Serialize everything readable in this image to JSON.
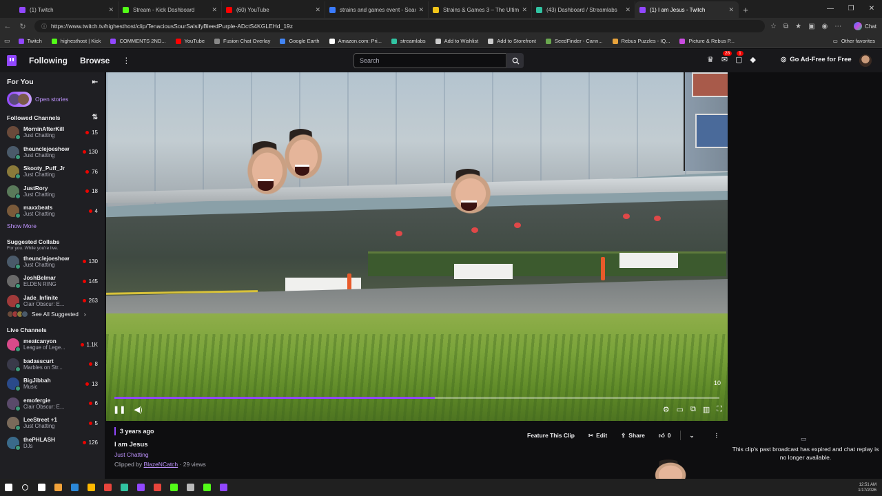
{
  "browser": {
    "tabs": [
      {
        "title": "(1) Twitch",
        "color": "#9147ff",
        "active": false
      },
      {
        "title": "Stream - Kick Dashboard",
        "color": "#53fc18",
        "active": false
      },
      {
        "title": "(60) YouTube",
        "color": "#ff0000",
        "active": false
      },
      {
        "title": "strains and games event - Search",
        "color": "#3a7bff",
        "active": false
      },
      {
        "title": "Strains & Games 3 – The Ultimate",
        "color": "#f0c419",
        "active": false
      },
      {
        "title": "(43) Dashboard / Streamlabs",
        "color": "#31c3a2",
        "active": false
      },
      {
        "title": "(1) I am Jesus - Twitch",
        "color": "#9147ff",
        "active": true
      }
    ],
    "url": "https://www.twitch.tv/highesthost/clip/TenaciousSourSalsifyBleedPurple-ADctS4KGLEHd_19z",
    "copilot_label": "Chat",
    "bookmarks": [
      {
        "label": "Twitch",
        "color": "#9147ff"
      },
      {
        "label": "highesthost | Kick",
        "color": "#53fc18"
      },
      {
        "label": "COMMENTS 2ND...",
        "color": "#9147ff"
      },
      {
        "label": "YouTube",
        "color": "#ff0000"
      },
      {
        "label": "Fusion Chat Overlay",
        "color": "#888888"
      },
      {
        "label": "Google Earth",
        "color": "#4285f4"
      },
      {
        "label": "Amazon.com: Pri...",
        "color": "#ffffff"
      },
      {
        "label": "streamlabs",
        "color": "#31c3a2"
      },
      {
        "label": "Add to Wishlist",
        "color": "#cccccc"
      },
      {
        "label": "Add to Storefront",
        "color": "#cccccc"
      },
      {
        "label": "SeedFinder - Cann...",
        "color": "#6aa84f"
      },
      {
        "label": "Rebus Puzzles - IQ...",
        "color": "#e8a33c"
      },
      {
        "label": "Picture & Rebus P...",
        "color": "#c94ce0"
      }
    ],
    "other_favorites": "Other favorites"
  },
  "twitch_nav": {
    "following": "Following",
    "browse": "Browse",
    "more": "⋮",
    "search_placeholder": "Search",
    "notif_badge": "28",
    "inbox_badge": "1",
    "ad_free": "Go Ad-Free for Free"
  },
  "sidebar": {
    "for_you": "For You",
    "open_stories": "Open stories",
    "followed_title": "Followed Channels",
    "followed": [
      {
        "name": "MorninAfterKill",
        "game": "Just Chatting",
        "viewers": "15",
        "color": "#6a4a3a"
      },
      {
        "name": "theunclejoeshow",
        "game": "Just Chatting",
        "viewers": "130",
        "color": "#4a5a6a"
      },
      {
        "name": "Skooty_Puff_Jr",
        "game": "Just Chatting",
        "viewers": "76",
        "color": "#8a7a3a"
      },
      {
        "name": "JustRory",
        "game": "Just Chatting",
        "viewers": "18",
        "color": "#5a7a5a"
      },
      {
        "name": "maxxbeats",
        "game": "Just Chatting",
        "viewers": "4",
        "color": "#7a5a3a"
      }
    ],
    "show_more": "Show More",
    "suggested_title": "Suggested Collabs",
    "suggested_sub": "For you. While you're live.",
    "suggested": [
      {
        "name": "theunclejoeshow",
        "game": "Just Chatting",
        "viewers": "130",
        "color": "#4a5a6a"
      },
      {
        "name": "JoshBelmar",
        "game": "ELDEN RING",
        "viewers": "145",
        "color": "#6a6a6a"
      },
      {
        "name": "Jade_Infinite",
        "game": "Clair Obscur: E...",
        "viewers": "263",
        "color": "#a03a3a"
      }
    ],
    "see_all": "See All Suggested",
    "live_title": "Live Channels",
    "live": [
      {
        "name": "meatcanyon",
        "game": "League of Lege...",
        "viewers": "1.1K",
        "color": "#d84a8a"
      },
      {
        "name": "badasscurt",
        "game": "Marbles on Str...",
        "viewers": "8",
        "color": "#3a3a4a"
      },
      {
        "name": "BigJibbah",
        "game": "Music",
        "viewers": "13",
        "color": "#2a4a8a"
      },
      {
        "name": "emofergie",
        "game": "Clair Obscur: E...",
        "viewers": "6",
        "color": "#5a4a6a"
      },
      {
        "name": "LeeStreet +1",
        "game": "Just Chatting",
        "viewers": "5",
        "color": "#7a6a5a"
      },
      {
        "name": "thePHLASH",
        "game": "DJs",
        "viewers": "126",
        "color": "#3a6a8a"
      }
    ]
  },
  "clip": {
    "age": "3 years ago",
    "title": "I am Jesus",
    "category": "Just Chatting",
    "clipped_by_prefix": "Clipped by",
    "clipper": "BlazeNCatch",
    "views": "· 29 views",
    "timer": "10",
    "progress_fraction": 0.53,
    "feature_label": "Feature This Clip",
    "edit_label": "Edit",
    "share_label": "Share",
    "like_count": "0"
  },
  "chat": {
    "notice": "This clip's past broadcast has expired and chat replay is no longer available."
  },
  "taskbar": {
    "time": "12:51 AM",
    "date": "1/17/2026",
    "apps": [
      "#ffffff",
      "#ffffff",
      "#ffffff",
      "#f2a33a",
      "#2b88d8",
      "#ffb900",
      "#e8453c",
      "#31c3a2",
      "#9147ff",
      "#e8453c",
      "#53fc18",
      "#bbbbbb",
      "#53fc18",
      "#9147ff"
    ]
  }
}
